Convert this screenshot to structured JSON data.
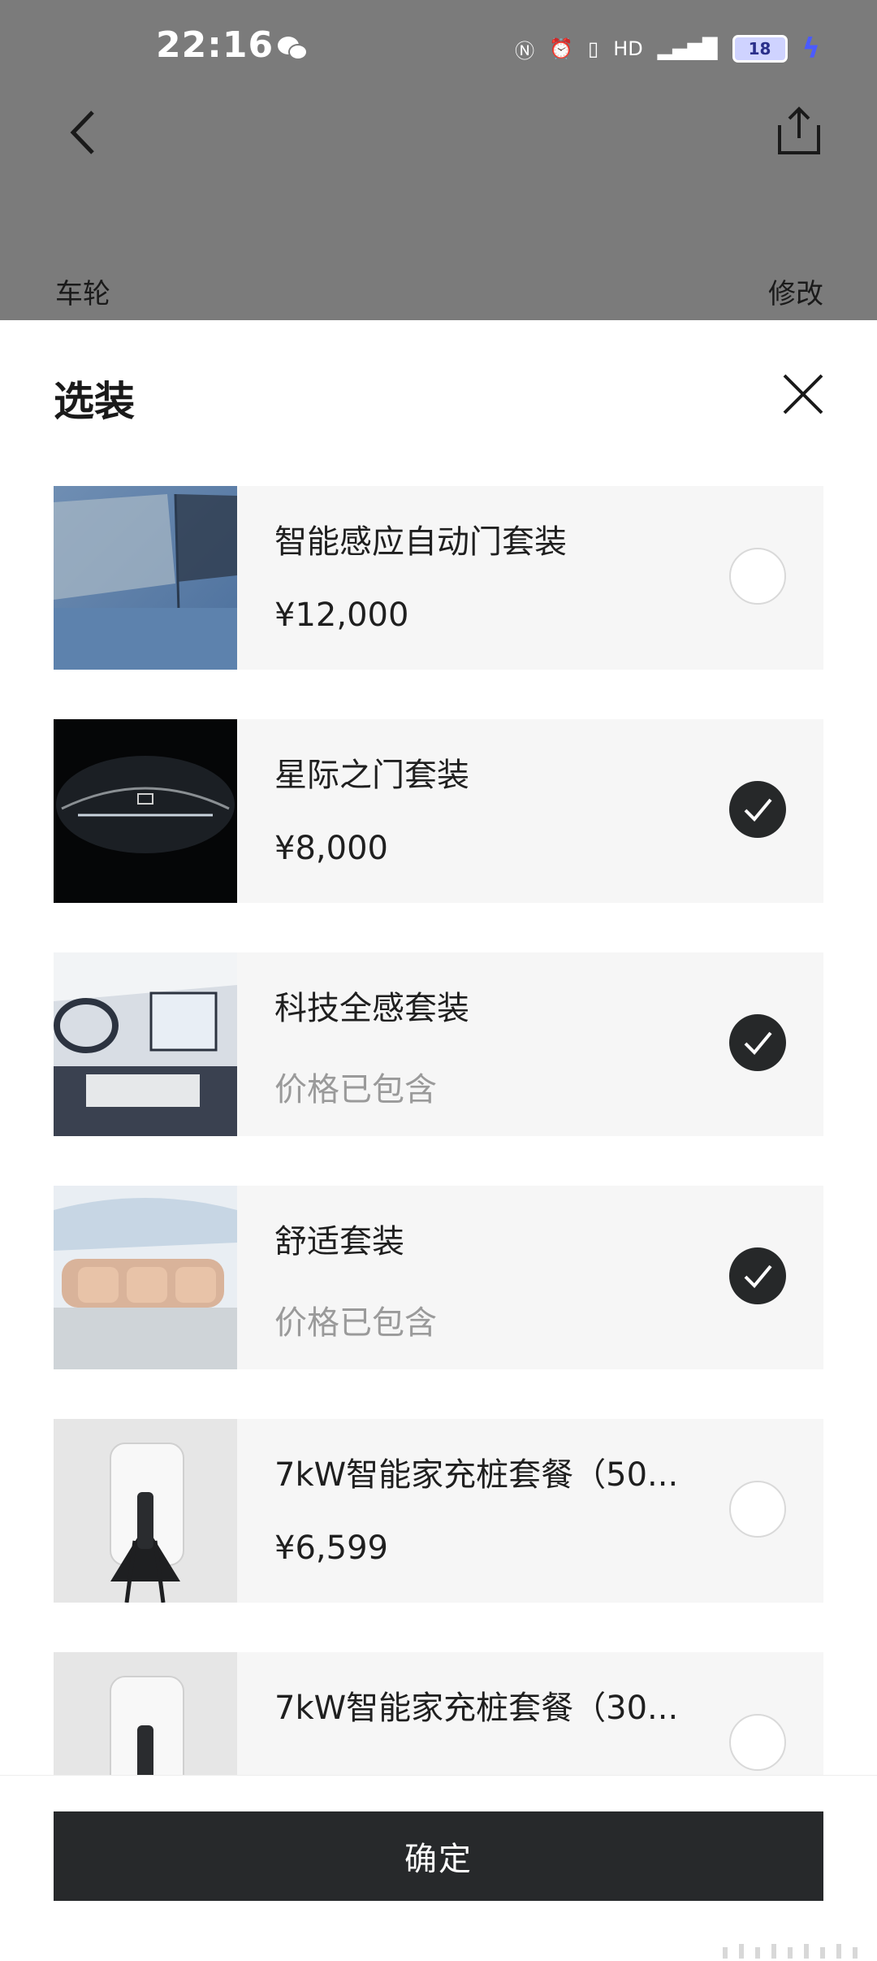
{
  "status_bar": {
    "time": "22:16",
    "battery": "18"
  },
  "background_page": {
    "row_label": "车轮",
    "row_action": "修改"
  },
  "sheet": {
    "title": "选装"
  },
  "options": [
    {
      "name": "智能感应自动门套装",
      "price": "¥12,000",
      "selected": false,
      "image": "blue-car-door"
    },
    {
      "name": "星际之门套装",
      "price": "¥8,000",
      "selected": true,
      "image": "car-front-dark"
    },
    {
      "name": "科技全感套装",
      "price": "价格已包含",
      "selected": true,
      "image": "car-interior-dashboard"
    },
    {
      "name": "舒适套装",
      "price": "价格已包含",
      "selected": true,
      "image": "rear-seats"
    },
    {
      "name": "7kW智能家充桩套餐（50...",
      "price": "¥6,599",
      "selected": false,
      "image": "wall-charger"
    },
    {
      "name": "7kW智能家充桩套餐（30...",
      "price": "",
      "selected": false,
      "image": "wall-charger"
    }
  ],
  "footer": {
    "confirm_label": "确定"
  },
  "colors": {
    "dim_overlay": "#7b7b7b",
    "card_bg": "#f6f6f6",
    "checked": "#262829",
    "button_bg": "#27292b"
  }
}
